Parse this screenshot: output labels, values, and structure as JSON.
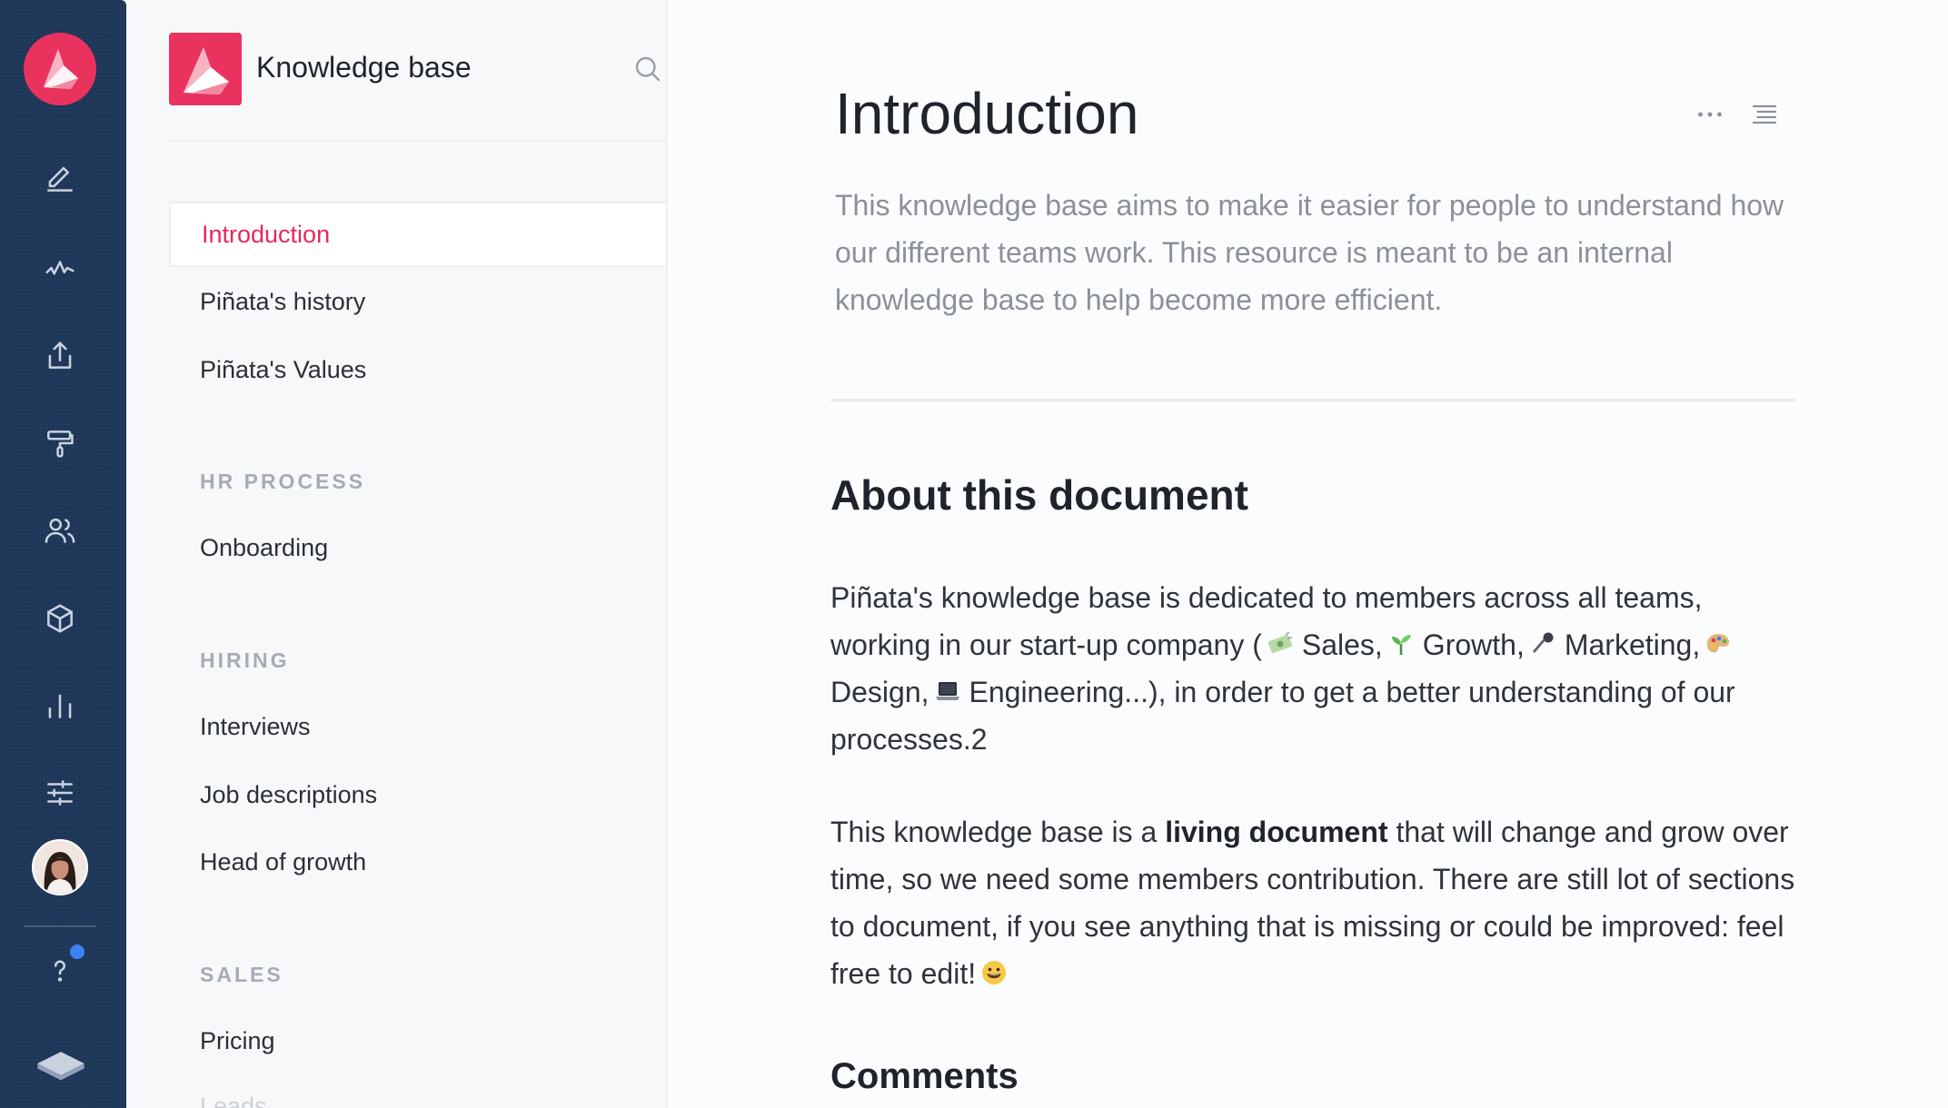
{
  "rail": {
    "icons": [
      "edit-icon",
      "activity-icon",
      "share-icon",
      "paint-roller-icon",
      "users-icon",
      "cube-icon",
      "bar-chart-icon",
      "sliders-icon",
      "help-icon",
      "book-icon"
    ],
    "notification_color": "#3b82f6"
  },
  "sidebar": {
    "title": "Knowledge base",
    "items_top": [
      {
        "label": "Introduction",
        "active": true
      },
      {
        "label": "Piñata's history"
      },
      {
        "label": "Piñata's Values"
      }
    ],
    "sections": [
      {
        "title": "HR PROCESS",
        "items": [
          "Onboarding"
        ]
      },
      {
        "title": "HIRING",
        "items": [
          "Interviews",
          "Job descriptions",
          "Head of growth"
        ]
      },
      {
        "title": "SALES",
        "items": [
          "Pricing",
          "Leads"
        ]
      }
    ]
  },
  "document": {
    "title": "Introduction",
    "lead": "This knowledge base aims to make it easier for people to understand how our different teams work. This resource is meant to be an internal knowledge base to help become more efficient.",
    "section_title": "About this document",
    "p1": {
      "a": "Piñata's knowledge base is dedicated to members across all teams, working in our start-up company (",
      "sales": "Sales,",
      "growth": "Growth,",
      "marketing": "Marketing,",
      "design": "Design,",
      "engineering": "Engineering...), in order to get a better understanding of our processes.2"
    },
    "p2": {
      "a": "This knowledge base is a ",
      "bold": "living document",
      "b": " that will change and grow over time, so we need some members contribution. There are still lot of sections to document, if you see anything that is missing or could be improved: feel free to edit!"
    },
    "comments_title": "Comments"
  },
  "colors": {
    "rail_bg": "#1d3557",
    "accent": "#e6295c",
    "sidebar_bg": "#f6f8fa"
  }
}
